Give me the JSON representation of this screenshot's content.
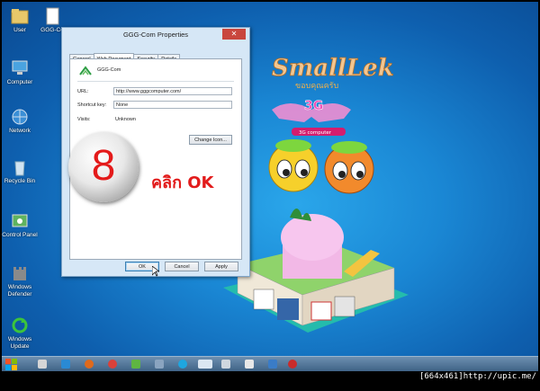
{
  "desktop_icons": [
    {
      "label": "User"
    },
    {
      "label": "GGG-Co"
    },
    {
      "label": "Computer"
    },
    {
      "label": "Network"
    },
    {
      "label": "Recycle Bin"
    },
    {
      "label": "Control Panel"
    },
    {
      "label": "Windows Defender"
    },
    {
      "label": "Windows Update"
    }
  ],
  "window": {
    "title": "GGG-Com Properties",
    "close_glyph": "✕",
    "tabs": [
      "General",
      "Web Document",
      "Security",
      "Details"
    ],
    "shortcut_name": "GGG-Com",
    "url_label": "URL:",
    "url_value": "http://www.gggcomputer.com/",
    "shortcut_key_label": "Shortcut key:",
    "shortcut_key_value": "None",
    "visits_label": "Visits:",
    "visits_value": "Unknown",
    "change_icon_label": "Change Icon...",
    "ok_label": "OK",
    "cancel_label": "Cancel",
    "apply_label": "Apply"
  },
  "overlay": {
    "step_number": "8",
    "instruction": "คลิก OK"
  },
  "wallpaper": {
    "title": "SmallLek",
    "subtitle": "ขอบคุณครับ",
    "logo_text": "3G",
    "logo_sub": "3G computer"
  },
  "footer": {
    "text": "[664x461]http://upic.me/"
  },
  "colors": {
    "accent_red": "#e21b1b",
    "desktop_blue": "#1a87d4",
    "window_frame": "#d6e7f6"
  }
}
